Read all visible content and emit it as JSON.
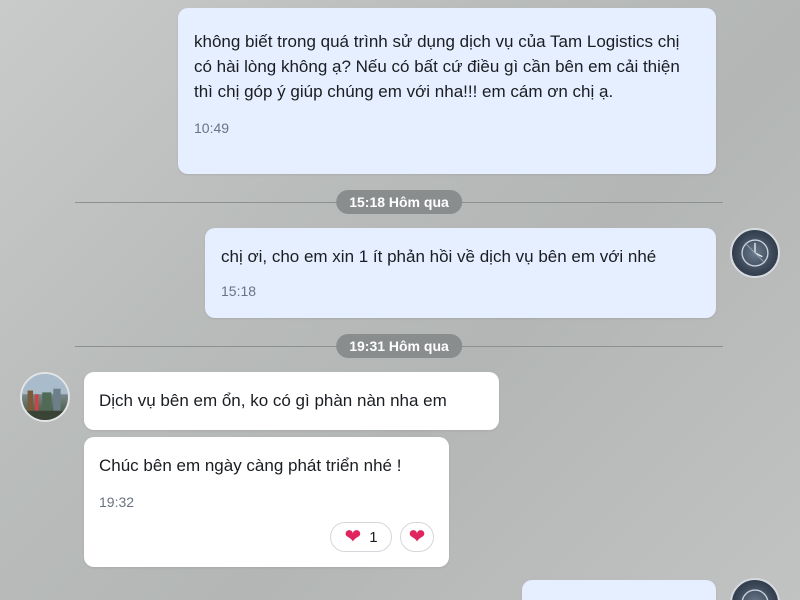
{
  "messages": {
    "m1": {
      "text": "không biết trong quá trình sử dụng dịch vụ của Tam Logistics chị có hài lòng không ạ? Nếu có bất cứ điều gì cần bên em cải thiện thì chị góp ý giúp chúng em với nha!!! em cám ơn chị ạ.",
      "time": "10:49"
    },
    "m2": {
      "text": "chị ơi, cho em xin 1 ít phản hồi về dịch vụ bên em với nhé",
      "time": "15:18"
    },
    "m3": {
      "text": "Dịch vụ bên em ổn, ko có gì phàn nàn nha em"
    },
    "m4": {
      "text": "Chúc bên em ngày càng phát triển nhé !",
      "time": "19:32",
      "reactions": [
        {
          "icon": "heart-icon",
          "count": "1"
        },
        {
          "icon": "heart-icon"
        }
      ]
    }
  },
  "dividers": {
    "d1": "15:18 Hôm qua",
    "d2": "19:31 Hôm qua"
  },
  "colors": {
    "outgoing_bubble": "#e5efff",
    "incoming_bubble": "#ffffff",
    "divider_pill": "#8a8d8e",
    "reaction_heart": "#e0245e"
  }
}
